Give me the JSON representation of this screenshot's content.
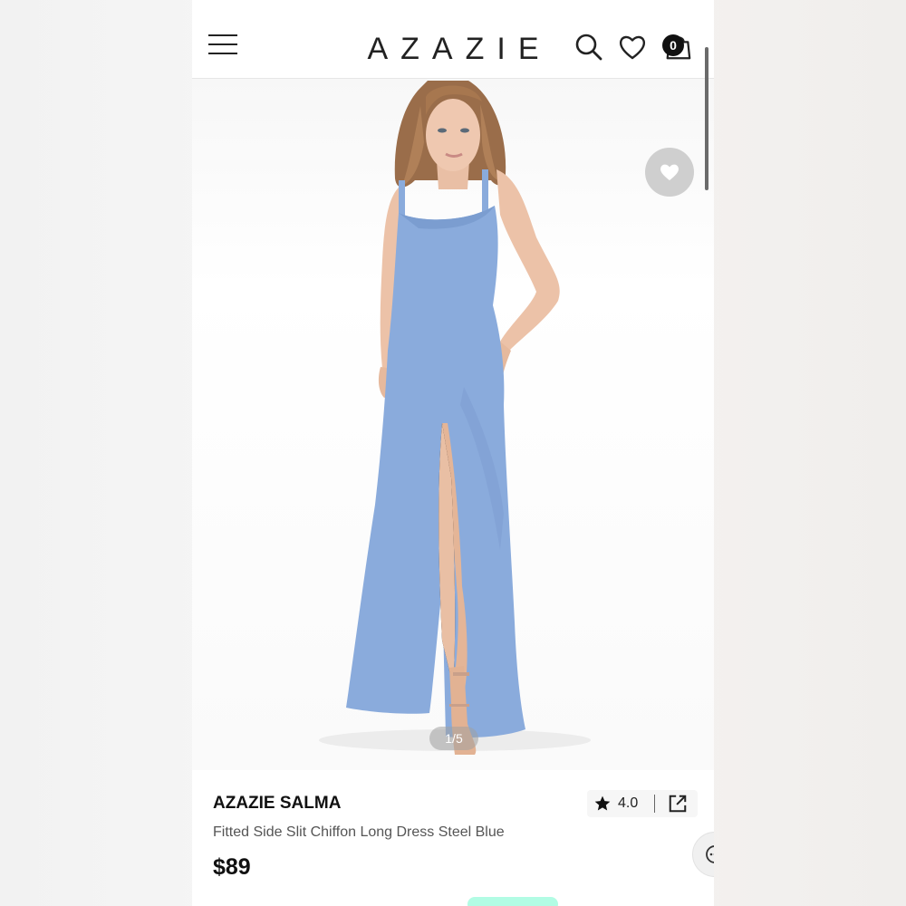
{
  "header": {
    "logo": "AZAZIE",
    "bag_count": "0"
  },
  "gallery": {
    "counter": "1/5"
  },
  "product": {
    "brand": "AZAZIE SALMA",
    "name": "Fitted Side Slit Chiffon Long Dress Steel Blue",
    "price": "$89",
    "rating": "4.0",
    "dress_color": "#8aabdc"
  },
  "icons": {
    "menu": "hamburger-icon",
    "search": "search-icon",
    "wishlist": "heart-icon",
    "bag": "shopping-bag-icon",
    "favorite": "heart-icon",
    "rating": "star-icon",
    "share": "share-icon",
    "chat": "chat-icon"
  },
  "colors": {
    "accent": "#111111",
    "afterpay": "#b2fce4"
  }
}
